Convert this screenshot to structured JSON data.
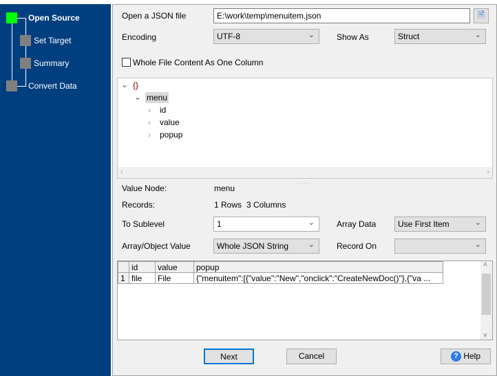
{
  "wizard": {
    "steps": [
      {
        "label": "Open Source",
        "active": true
      },
      {
        "label": "Set Target"
      },
      {
        "label": "Summary"
      },
      {
        "label": "Convert Data"
      }
    ],
    "active_color": "#00ff00"
  },
  "form": {
    "file_label": "Open a JSON file",
    "file_value": "E:\\work\\temp\\menuitem.json",
    "encoding_label": "Encoding",
    "encoding_value": "UTF-8",
    "show_as_label": "Show As",
    "show_as_value": "Struct",
    "whole_file_label": "Whole File Content As One Column",
    "whole_file_checked": false,
    "value_node_label": "Value Node:",
    "value_node": "menu",
    "records_label": "Records:",
    "records_rows": "1 Rows",
    "records_cols": "3 Columns",
    "sublevel_label": "To Sublevel",
    "sublevel_value": "1",
    "array_data_label": "Array Data",
    "array_data_value": "Use First Item",
    "array_object_label": "Array/Object Value",
    "array_object_value": "Whole JSON String",
    "record_on_label": "Record On",
    "record_on_value": ""
  },
  "tree": {
    "root": "{}",
    "node": "menu",
    "children": [
      "id",
      "value",
      "popup"
    ]
  },
  "grid": {
    "headers": [
      "",
      "id",
      "value",
      "popup"
    ],
    "rows": [
      [
        "1",
        "file",
        "File",
        "{\"menuitem\":[{\"value\":\"New\",\"onclick\":\"CreateNewDoc()\"},{\"va ..."
      ]
    ]
  },
  "buttons": {
    "next": "Next",
    "cancel": "Cancel",
    "help": "Help"
  }
}
